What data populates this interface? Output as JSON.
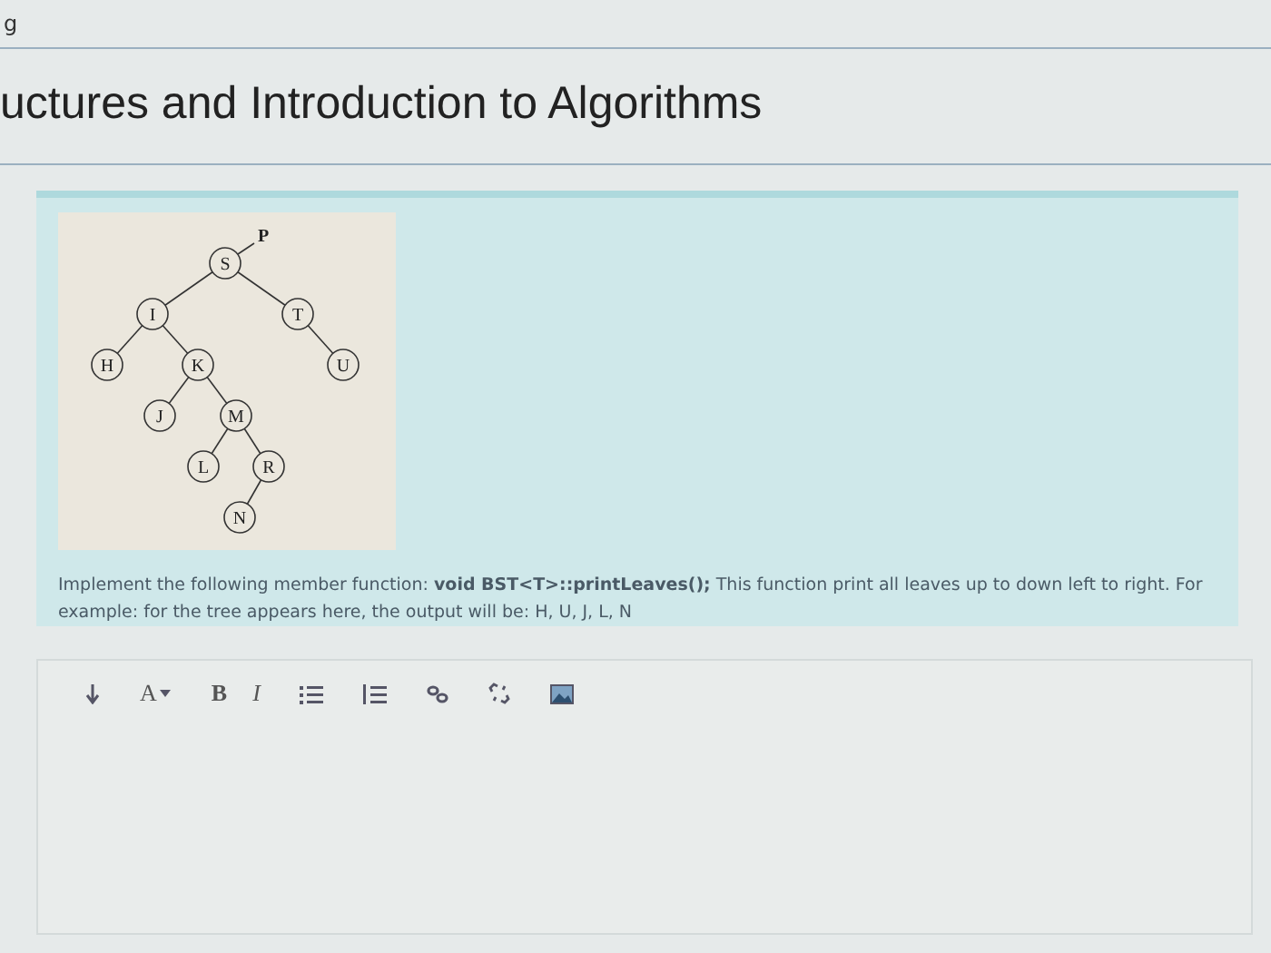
{
  "header": {
    "fragment": "g",
    "title": "uctures and Introduction to Algorithms"
  },
  "question": {
    "tree": {
      "pointer_label": "P",
      "root": {
        "label": "S",
        "left": {
          "label": "I",
          "left": {
            "label": "H"
          },
          "right": {
            "label": "K",
            "left": {
              "label": "J"
            },
            "right": {
              "label": "M",
              "left": {
                "label": "L"
              },
              "right": {
                "label": "R",
                "left": {
                  "label": "N"
                }
              }
            }
          }
        },
        "right": {
          "label": "T",
          "right": {
            "label": "U"
          }
        }
      }
    },
    "text": "Implement the following member function: **void BST<T>::printLeaves();** This function print all leaves up to down left to right. For example: for the tree appears here, the output will be: H, U, J, L, N"
  },
  "editor": {
    "toolbar": [
      {
        "kind": "direction"
      },
      {
        "kind": "dropdown",
        "label": "A"
      },
      {
        "kind": "bold",
        "label": "B"
      },
      {
        "kind": "italic",
        "label": "I"
      },
      {
        "kind": "bullets"
      },
      {
        "kind": "numbers"
      },
      {
        "kind": "link"
      },
      {
        "kind": "unlink"
      },
      {
        "kind": "image"
      }
    ]
  }
}
